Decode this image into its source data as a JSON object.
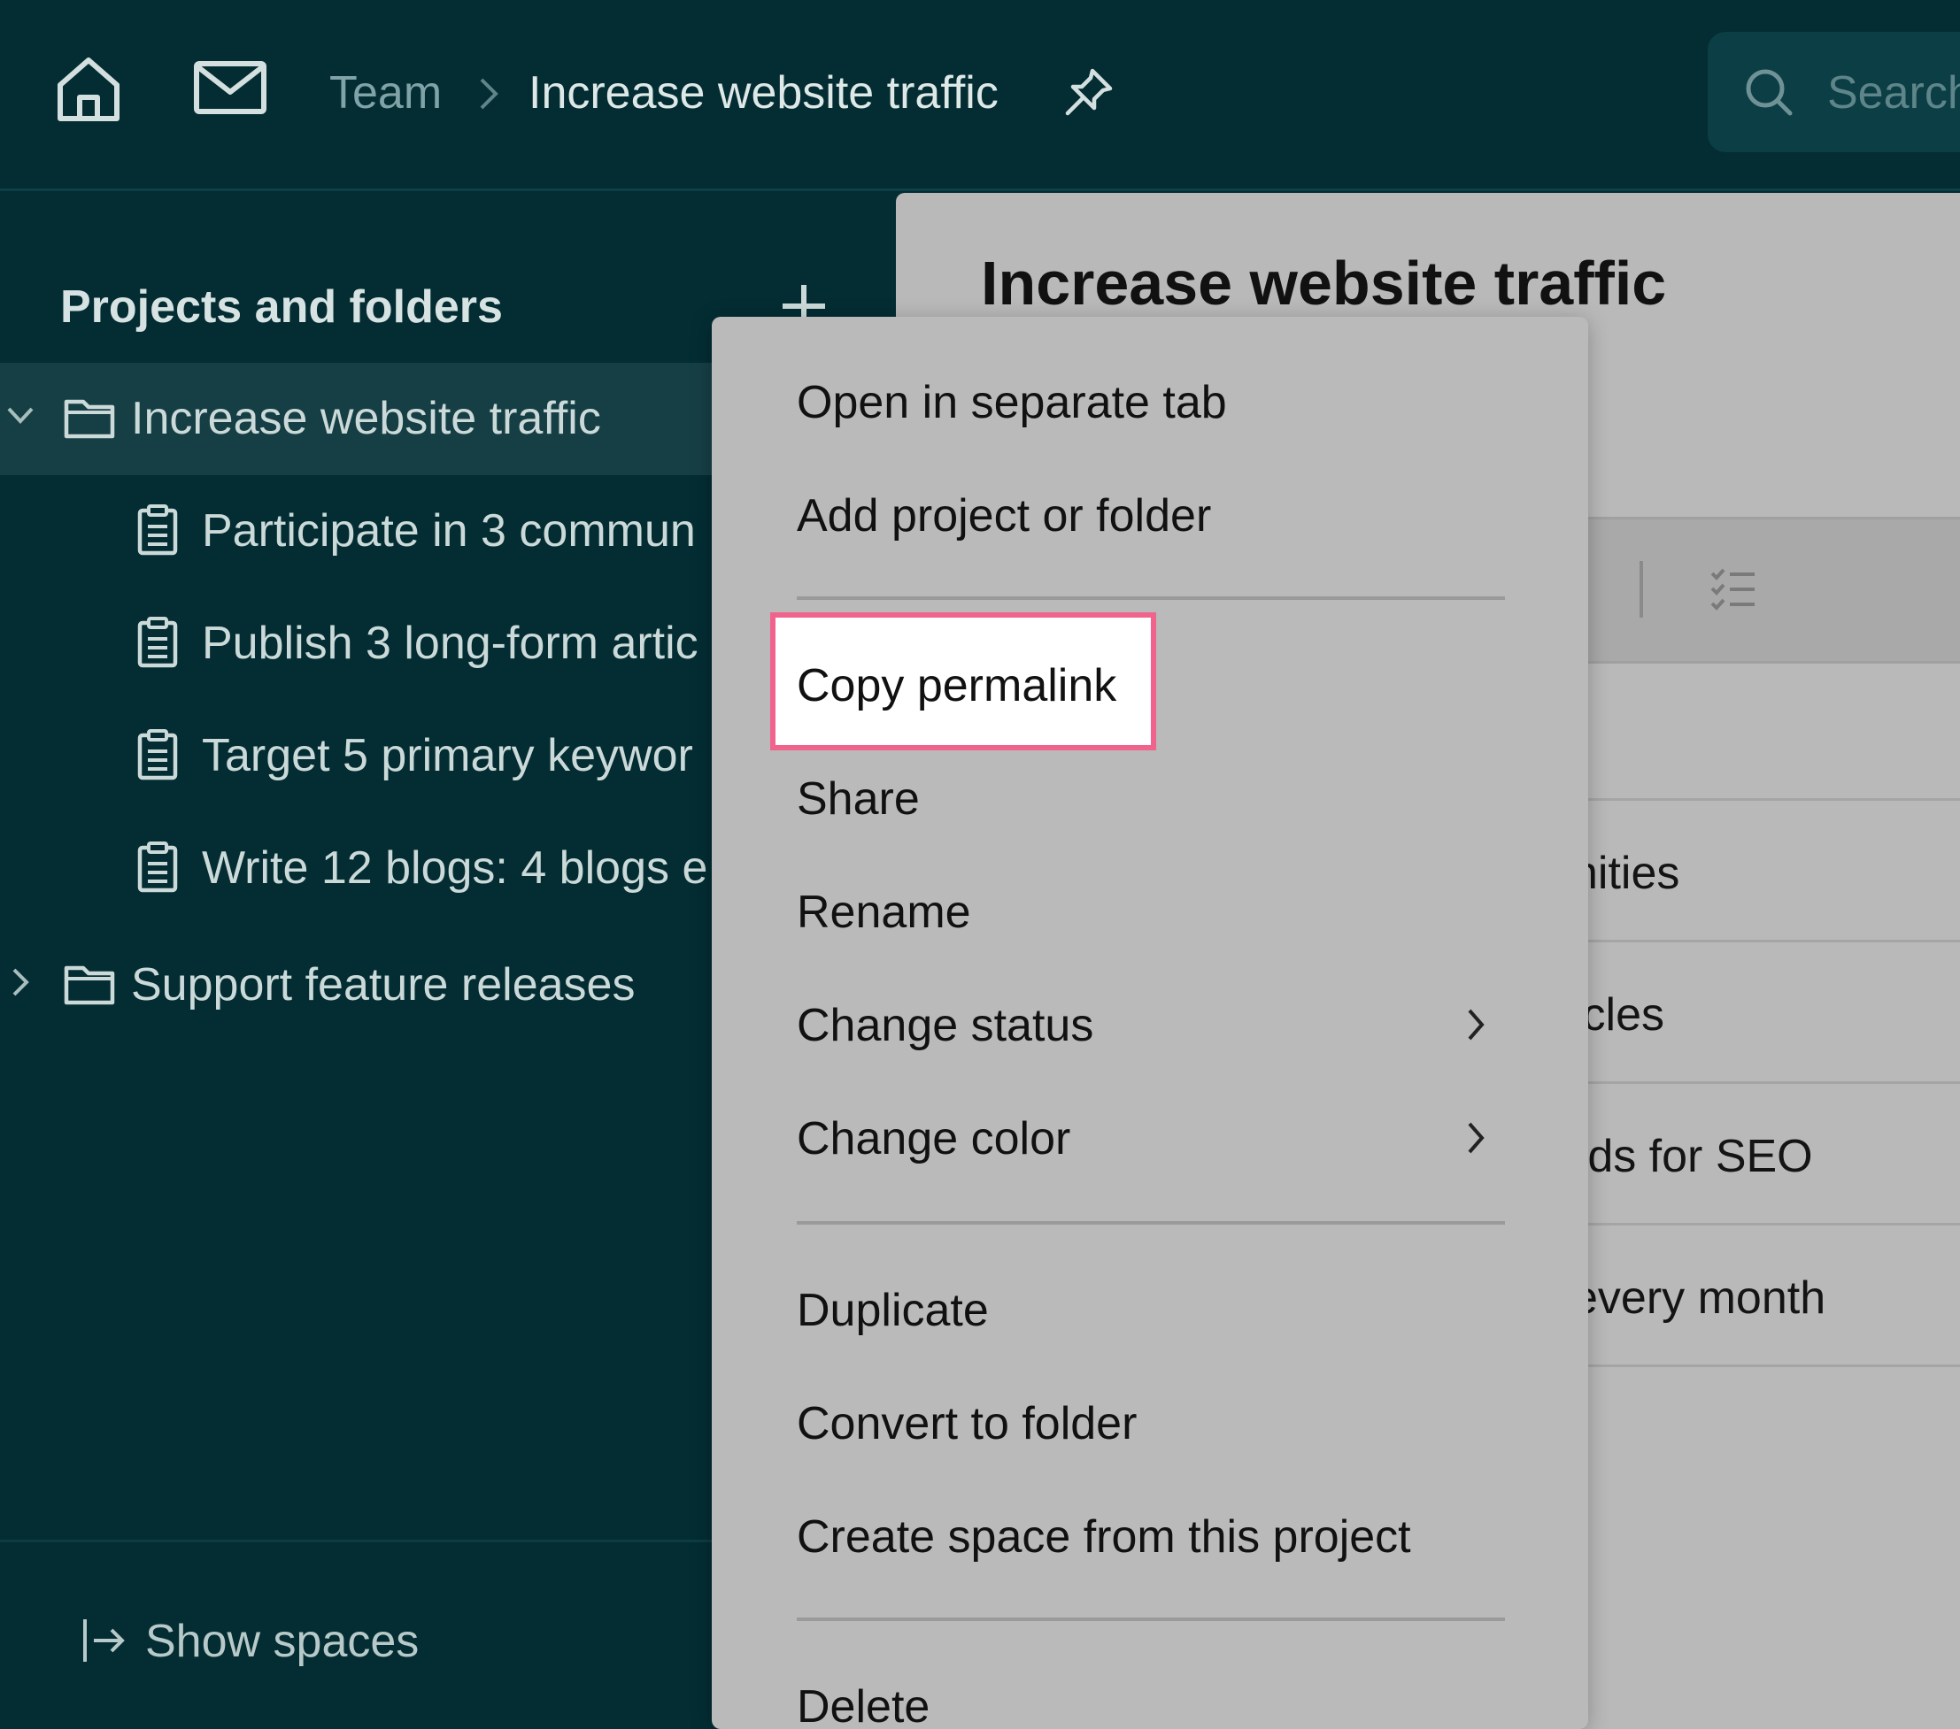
{
  "topbar": {
    "breadcrumb_team": "Team",
    "breadcrumb_current": "Increase website traffic",
    "search_placeholder": "Search"
  },
  "sidebar": {
    "title": "Projects and folders",
    "items": [
      {
        "label": "Increase website traffic",
        "type": "folder",
        "expanded": true,
        "selected": true
      },
      {
        "label": "Participate in 3 commun",
        "type": "project"
      },
      {
        "label": "Publish 3 long-form artic",
        "type": "project"
      },
      {
        "label": "Target 5 primary keywor",
        "type": "project"
      },
      {
        "label": "Write 12 blogs: 4 blogs e",
        "type": "project"
      },
      {
        "label": "Support feature releases",
        "type": "folder",
        "expanded": false
      }
    ],
    "footer_label": "Show spaces"
  },
  "main": {
    "title": "Increase website traffic",
    "row_fragments": [
      "nities",
      "icles",
      "rds for SEO",
      "every month"
    ]
  },
  "context_menu": {
    "items": [
      {
        "label": "Open in separate tab"
      },
      {
        "label": "Add project or folder"
      },
      {
        "label": "Copy permalink",
        "highlighted": true
      },
      {
        "label": "Share"
      },
      {
        "label": "Rename"
      },
      {
        "label": "Change status",
        "submenu": true
      },
      {
        "label": "Change color",
        "submenu": true
      },
      {
        "label": "Duplicate"
      },
      {
        "label": "Convert to folder"
      },
      {
        "label": "Create space from this project"
      },
      {
        "label": "Delete"
      }
    ]
  },
  "colors": {
    "topbar_bg": "#032d33",
    "sidebar_selected_bg": "#163f45",
    "menu_bg": "#bababa",
    "highlight_border": "#f0638d"
  },
  "icons": [
    "home-icon",
    "mail-icon",
    "chevron-right-icon",
    "pin-icon",
    "search-icon",
    "plus-icon",
    "folder-icon",
    "clipboard-icon",
    "chevron-down-icon",
    "checklist-icon",
    "show-spaces-icon"
  ]
}
